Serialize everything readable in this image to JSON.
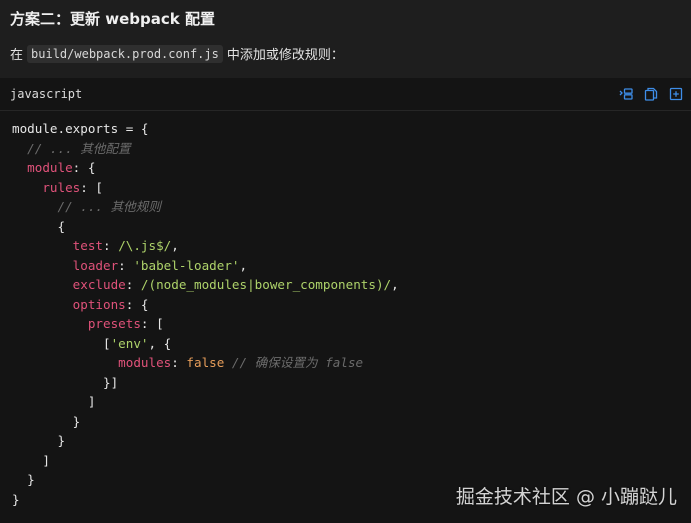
{
  "heading": "方案二：更新 webpack 配置",
  "description": {
    "prefix": "在",
    "code": "build/webpack.prod.conf.js",
    "suffix": "中添加或修改规则："
  },
  "code_block": {
    "language": "javascript",
    "tools": [
      {
        "name": "wrap-lines-icon"
      },
      {
        "name": "copy-icon"
      },
      {
        "name": "expand-icon"
      }
    ],
    "accent_color": "#3e8de8",
    "lines": [
      [
        {
          "t": "module.exports = {",
          "c": "plain"
        }
      ],
      [
        {
          "t": "  ",
          "c": "plain"
        },
        {
          "t": "// ... 其他配置",
          "c": "comment"
        }
      ],
      [
        {
          "t": "  ",
          "c": "plain"
        },
        {
          "t": "module",
          "c": "prop"
        },
        {
          "t": ": {",
          "c": "plain"
        }
      ],
      [
        {
          "t": "    ",
          "c": "plain"
        },
        {
          "t": "rules",
          "c": "prop"
        },
        {
          "t": ": [",
          "c": "plain"
        }
      ],
      [
        {
          "t": "      ",
          "c": "plain"
        },
        {
          "t": "// ... 其他规则",
          "c": "comment"
        }
      ],
      [
        {
          "t": "      {",
          "c": "plain"
        }
      ],
      [
        {
          "t": "        ",
          "c": "plain"
        },
        {
          "t": "test",
          "c": "prop"
        },
        {
          "t": ": ",
          "c": "plain"
        },
        {
          "t": "/\\.js$/",
          "c": "regex"
        },
        {
          "t": ",",
          "c": "plain"
        }
      ],
      [
        {
          "t": "        ",
          "c": "plain"
        },
        {
          "t": "loader",
          "c": "prop"
        },
        {
          "t": ": ",
          "c": "plain"
        },
        {
          "t": "'babel-loader'",
          "c": "str"
        },
        {
          "t": ",",
          "c": "plain"
        }
      ],
      [
        {
          "t": "        ",
          "c": "plain"
        },
        {
          "t": "exclude",
          "c": "prop"
        },
        {
          "t": ": ",
          "c": "plain"
        },
        {
          "t": "/(node_modules|bower_components)/",
          "c": "regex"
        },
        {
          "t": ",",
          "c": "plain"
        }
      ],
      [
        {
          "t": "        ",
          "c": "plain"
        },
        {
          "t": "options",
          "c": "prop"
        },
        {
          "t": ": {",
          "c": "plain"
        }
      ],
      [
        {
          "t": "          ",
          "c": "plain"
        },
        {
          "t": "presets",
          "c": "prop"
        },
        {
          "t": ": [",
          "c": "plain"
        }
      ],
      [
        {
          "t": "            [",
          "c": "plain"
        },
        {
          "t": "'env'",
          "c": "str"
        },
        {
          "t": ", {",
          "c": "plain"
        }
      ],
      [
        {
          "t": "              ",
          "c": "plain"
        },
        {
          "t": "modules",
          "c": "prop"
        },
        {
          "t": ": ",
          "c": "plain"
        },
        {
          "t": "false",
          "c": "bool"
        },
        {
          "t": " ",
          "c": "plain"
        },
        {
          "t": "// 确保设置为 false",
          "c": "comment"
        }
      ],
      [
        {
          "t": "            }]",
          "c": "plain"
        }
      ],
      [
        {
          "t": "          ]",
          "c": "plain"
        }
      ],
      [
        {
          "t": "        }",
          "c": "plain"
        }
      ],
      [
        {
          "t": "      }",
          "c": "plain"
        }
      ],
      [
        {
          "t": "    ]",
          "c": "plain"
        }
      ],
      [
        {
          "t": "  }",
          "c": "plain"
        }
      ],
      [
        {
          "t": "}",
          "c": "plain"
        }
      ]
    ]
  },
  "watermark": "掘金技术社区 @ 小蹦跶儿"
}
